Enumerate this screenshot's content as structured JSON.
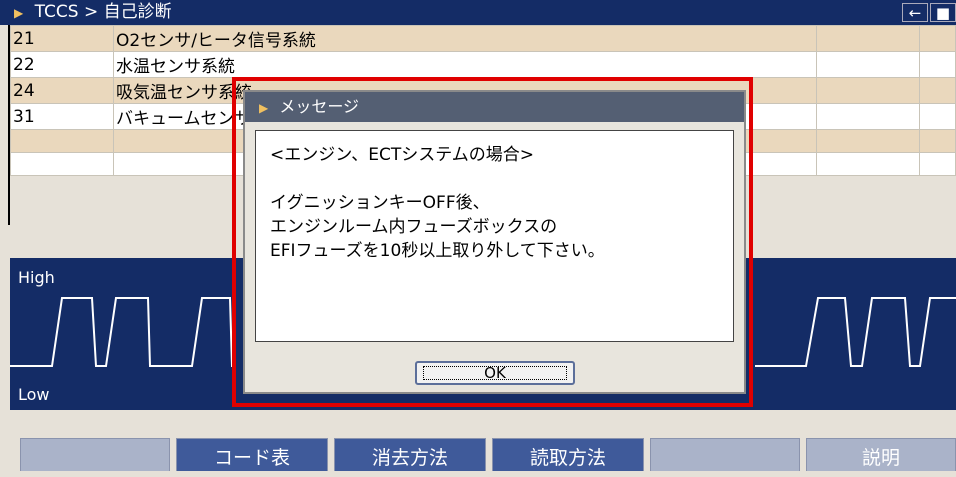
{
  "header": {
    "breadcrumb": "TCCS > 自己診断",
    "back_icon": "←",
    "camera_icon": "■"
  },
  "codes": [
    {
      "code": "21",
      "desc": "O2センサ/ヒータ信号系統"
    },
    {
      "code": "22",
      "desc": "水温センサ系統"
    },
    {
      "code": "24",
      "desc": "吸気温センサ系統"
    },
    {
      "code": "31",
      "desc": "バキュームセンサ系統"
    },
    {
      "code": "",
      "desc": ""
    },
    {
      "code": "",
      "desc": ""
    }
  ],
  "signal": {
    "high_label": "High",
    "low_label": "Low"
  },
  "dialog": {
    "title": "メッセージ",
    "lines": [
      "<エンジン、ECTシステムの場合>",
      "",
      "イグニッションキーOFF後、",
      "エンジンルーム内フューズボックスの",
      "EFIフューズを10秒以上取り外して下さい。"
    ],
    "ok_label": "OK"
  },
  "tabs": [
    {
      "label": "",
      "active": false
    },
    {
      "label": "コード表",
      "active": true
    },
    {
      "label": "消去方法",
      "active": true
    },
    {
      "label": "読取方法",
      "active": true
    },
    {
      "label": "",
      "active": false
    },
    {
      "label": "説明",
      "active": false
    }
  ],
  "colors": {
    "header_bg": "#142c66",
    "row_highlight": "#ead8bd",
    "highlight_box": "#e00000"
  }
}
